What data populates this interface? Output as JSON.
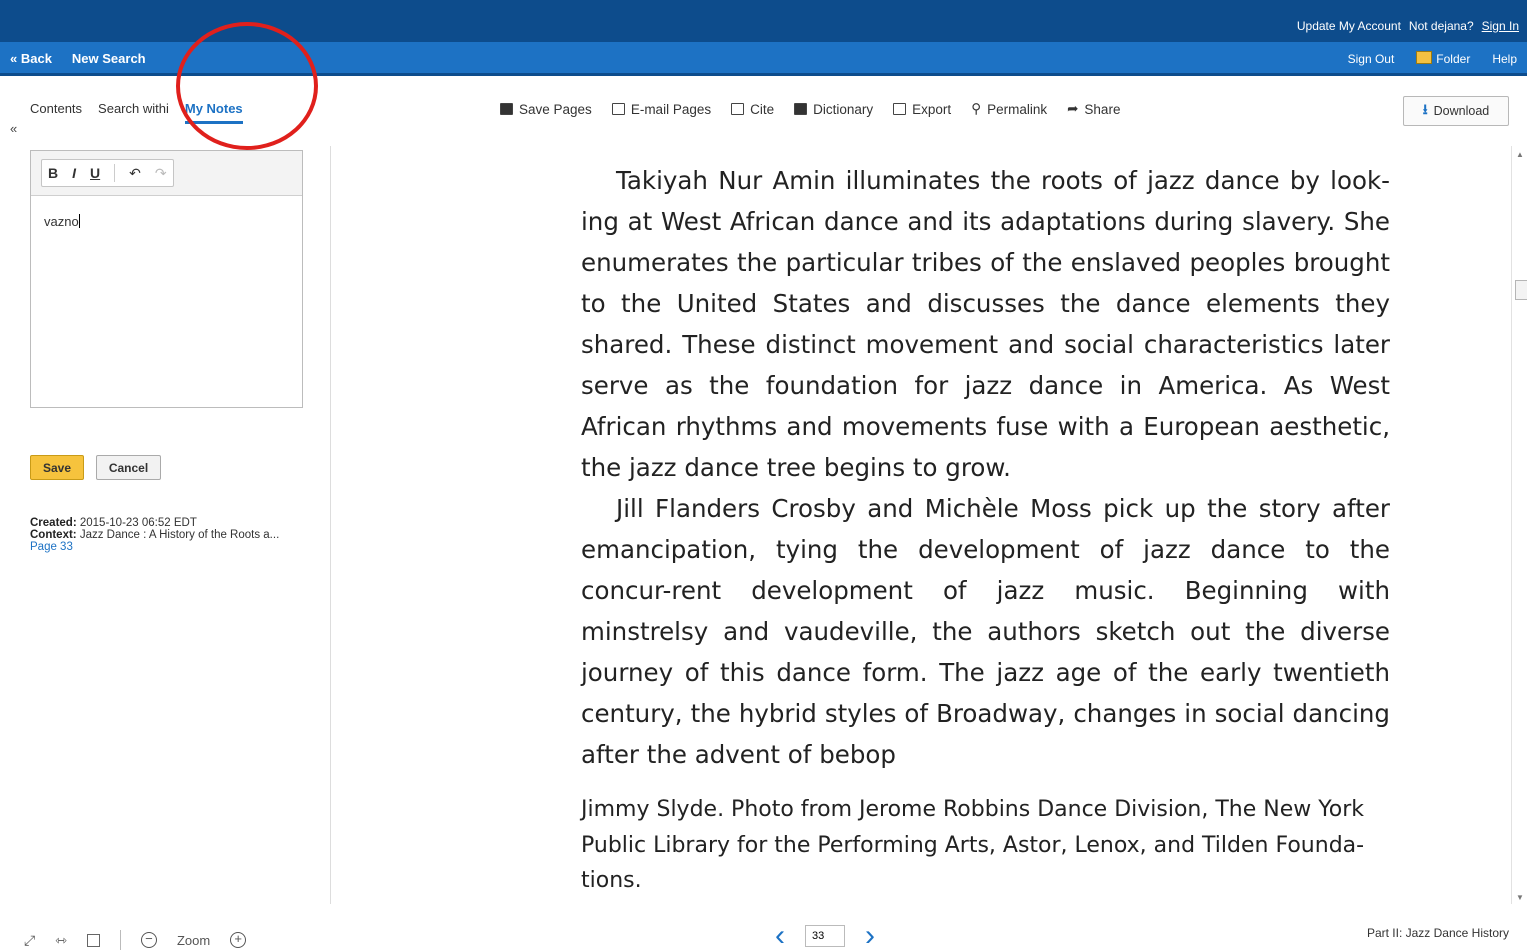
{
  "header": {
    "update_account": "Update My Account",
    "not_user": "Not dejana?",
    "sign_in": "Sign In"
  },
  "nav": {
    "back": "« Back",
    "new_search": "New Search",
    "sign_out": "Sign Out",
    "folder": "Folder",
    "help": "Help"
  },
  "side_tabs": {
    "contents": "Contents",
    "search_within": "Search withi",
    "my_notes": "My Notes",
    "collapse": "«"
  },
  "toolbar": {
    "save_pages": "Save Pages",
    "email_pages": "E-mail Pages",
    "cite": "Cite",
    "dictionary": "Dictionary",
    "export": "Export",
    "permalink": "Permalink",
    "share": "Share",
    "download": "Download"
  },
  "editor": {
    "bold": "B",
    "italic": "I",
    "underline": "U",
    "undo": "↶",
    "redo": "↷",
    "text": "vazno"
  },
  "note_actions": {
    "save": "Save",
    "cancel": "Cancel"
  },
  "note_meta": {
    "created_label": "Created:",
    "created_value": "2015-10-23 06:52 EDT",
    "context_label": "Context:",
    "context_value": "Jazz Dance : A History of the Roots a...",
    "page_link": "Page 33"
  },
  "page_text": {
    "para1": "Takiyah Nur Amin illuminates the roots of jazz dance by look-ing at West African dance and its adaptations during slavery. She enumerates the particular tribes of the enslaved peoples brought to the United States and discusses the dance elements they shared. These distinct movement and social characteristics later serve as the foundation for jazz dance in America. As West African rhythms and movements fuse with a European aesthetic, the jazz dance tree begins to grow.",
    "para2": "Jill Flanders Crosby and Michèle Moss pick up the story after emancipation, tying the development of jazz dance to the concur-rent development of jazz music. Beginning with minstrelsy and vaudeville, the authors sketch out the diverse journey of this dance form. The jazz age of the early twentieth century, the hybrid styles of Broadway, changes in social dancing after the advent of bebop",
    "caption": "Jimmy Slyde. Photo from Jerome Robbins Dance Division, The New York Public Library for the Performing Arts, Astor, Lenox, and Tilden Founda-tions."
  },
  "footer": {
    "zoom": "Zoom",
    "page_number": "33",
    "section": "Part II: Jazz Dance History"
  }
}
